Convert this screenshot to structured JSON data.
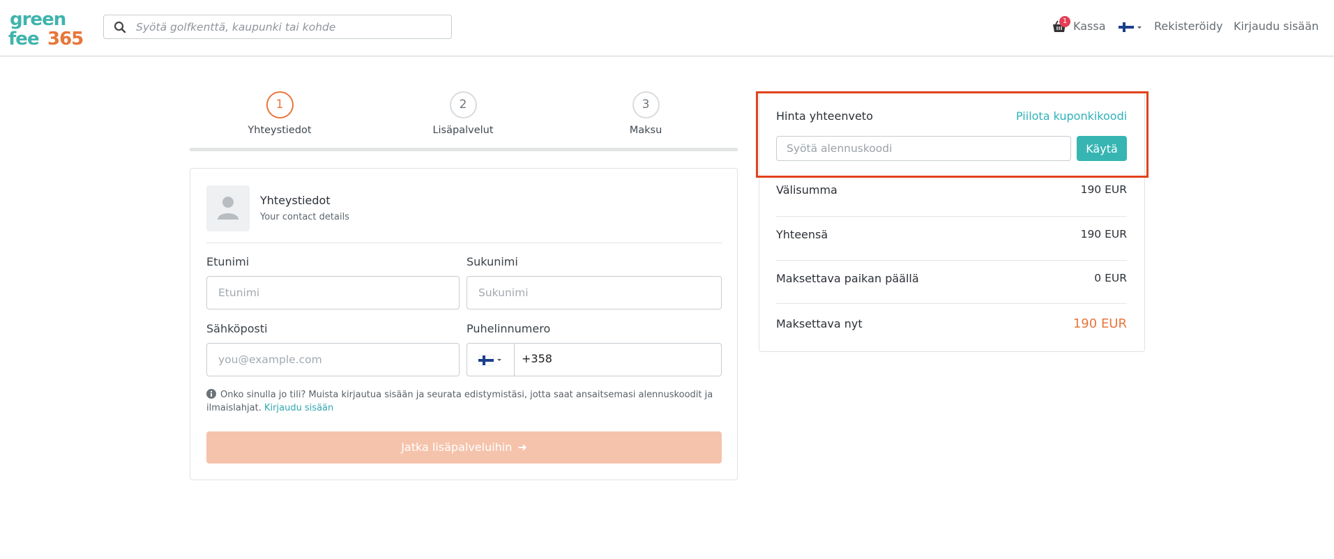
{
  "header": {
    "logo": {
      "line1": "green",
      "line2": "fee",
      "line3": "365"
    },
    "search_placeholder": "Syötä golfkenttä, kaupunki tai kohde",
    "cart_count": "1",
    "kassa_label": "Kassa",
    "language": "fi",
    "register_label": "Rekisteröidy",
    "login_label": "Kirjaudu sisään"
  },
  "stepper": {
    "steps": [
      {
        "number": "1",
        "label": "Yhteystiedot",
        "active": true
      },
      {
        "number": "2",
        "label": "Lisäpalvelut",
        "active": false
      },
      {
        "number": "3",
        "label": "Maksu",
        "active": false
      }
    ]
  },
  "contact": {
    "title": "Yhteystiedot",
    "subtitle": "Your contact details",
    "first_name_label": "Etunimi",
    "first_name_placeholder": "Etunimi",
    "last_name_label": "Sukunimi",
    "last_name_placeholder": "Sukunimi",
    "email_label": "Sähköposti",
    "email_placeholder": "you@example.com",
    "phone_label": "Puhelinnumero",
    "phone_code": "+358",
    "info_text": "Onko sinulla jo tili? Muista kirjautua sisään ja seurata edistymistäsi, jotta saat ansaitsemasi alennuskoodit ja ilmaislahjat.",
    "info_link": "Kirjaudu sisään",
    "continue_label": "Jatka lisäpalveluihin"
  },
  "summary": {
    "title": "Hinta yhteenveto",
    "hide_coupon_label": "Piilota kuponkikoodi",
    "coupon_placeholder": "Syötä alennuskoodi",
    "apply_label": "Käytä",
    "rows": [
      {
        "label": "Välisumma",
        "value": "190 EUR"
      },
      {
        "label": "Yhteensä",
        "value": "190 EUR"
      },
      {
        "label": "Maksettava paikan päällä",
        "value": "0 EUR"
      },
      {
        "label": "Maksettava nyt",
        "value": "190 EUR"
      }
    ]
  },
  "colors": {
    "brand_teal": "#36b5b3",
    "brand_orange": "#e8763a",
    "highlight_red": "#e0421b",
    "badge_red": "#e53e57"
  }
}
